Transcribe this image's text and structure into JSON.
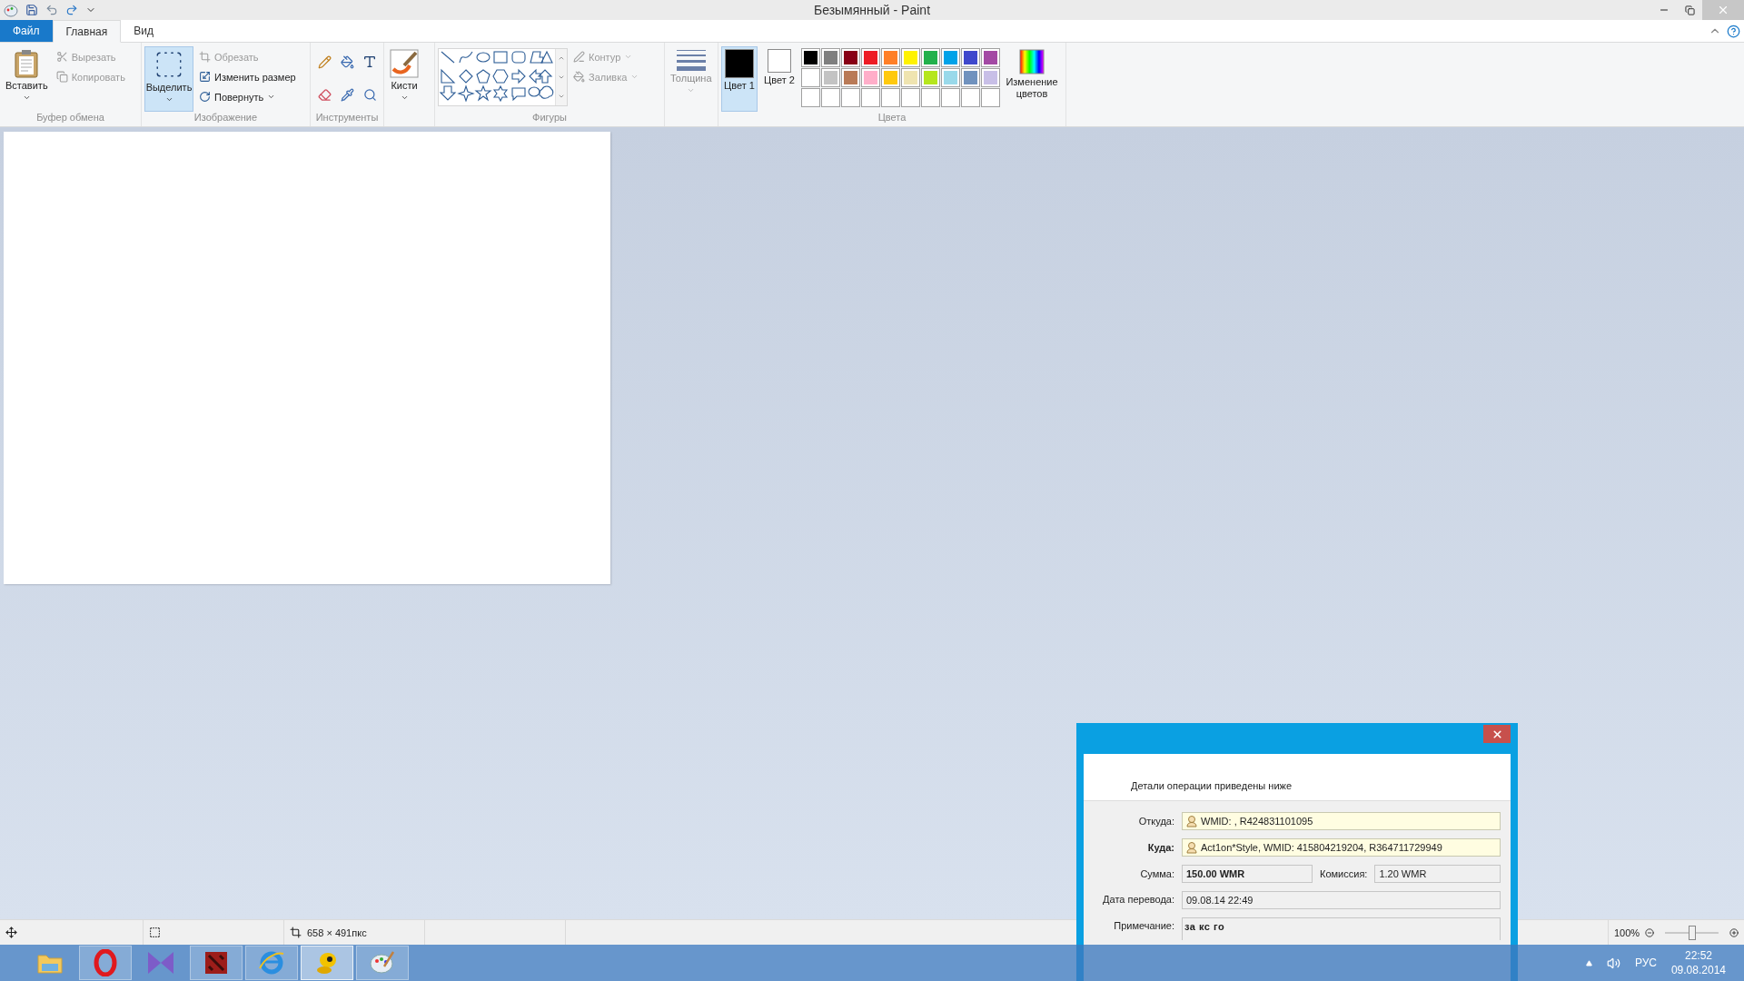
{
  "window": {
    "title": "Безымянный - Paint"
  },
  "ribbon_tabs": [
    {
      "label": "Файл",
      "kind": "file",
      "selected": false
    },
    {
      "label": "Главная",
      "kind": "tab",
      "selected": true
    },
    {
      "label": "Вид",
      "kind": "tab",
      "selected": false
    }
  ],
  "clipboard": {
    "label": "Буфер обмена",
    "paste": "Вставить",
    "cut": {
      "label": "Вырезать",
      "disabled": true
    },
    "copy": {
      "label": "Копировать",
      "disabled": true
    }
  },
  "image": {
    "label": "Изображение",
    "select": {
      "label": "Выделить",
      "selected": true
    },
    "crop": {
      "label": "Обрезать",
      "disabled": true
    },
    "resize": {
      "label": "Изменить размер",
      "disabled": false
    },
    "rotate": {
      "label": "Повернуть",
      "disabled": false
    }
  },
  "tools": {
    "label": "Инструменты"
  },
  "brushes": {
    "label": "Кисти"
  },
  "shapes": {
    "label": "Фигуры",
    "outline": {
      "label": "Контур",
      "disabled": true
    },
    "fill": {
      "label": "Заливка",
      "disabled": true
    }
  },
  "size": {
    "label": "Толщина",
    "disabled": true
  },
  "colors": {
    "label": "Цвета",
    "color1": {
      "label": "Цвет 1",
      "color": "#000000",
      "selected": true
    },
    "color2": {
      "label": "Цвет 2",
      "color": "#ffffff",
      "selected": false
    },
    "palette": [
      {
        "color": "#000000"
      },
      {
        "color": "#7f7f7f"
      },
      {
        "color": "#880015"
      },
      {
        "color": "#ed1c24"
      },
      {
        "color": "#ff7f27"
      },
      {
        "color": "#fff200"
      },
      {
        "color": "#22b14c"
      },
      {
        "color": "#00a2e8"
      },
      {
        "color": "#3f48cc"
      },
      {
        "color": "#a349a4"
      },
      {
        "color": "#ffffff"
      },
      {
        "color": "#c3c3c3"
      },
      {
        "color": "#b97a57"
      },
      {
        "color": "#ffaec9"
      },
      {
        "color": "#ffc90e"
      },
      {
        "color": "#efe4b0"
      },
      {
        "color": "#b5e61d"
      },
      {
        "color": "#99d9ea"
      },
      {
        "color": "#7092be"
      },
      {
        "color": "#c8bfe7"
      }
    ],
    "edit": "Изменение цветов"
  },
  "status_bar": {
    "dimensions": "658 × 491пкс",
    "zoom": "100%",
    "zoom_slider": {
      "level": 0.5
    }
  },
  "dialog": {
    "header": "Детали операции приведены ниже",
    "from": {
      "label": "Откуда:",
      "value": "WMID: , R424831101095"
    },
    "to": {
      "label": "Куда:",
      "value": "Act1on*Style, WMID: 415804219204, R364711729949"
    },
    "amount": {
      "label": "Сумма:",
      "value": "150.00 WMR"
    },
    "fee": {
      "label": "Комиссия:",
      "value": "1.20 WMR"
    },
    "date": {
      "label": "Дата перевода:",
      "value": "09.08.14 22:49"
    },
    "note": {
      "label": "Примечание:",
      "value": "за кс го"
    }
  },
  "taskbar": {
    "apps": [
      {
        "kind": "explorer",
        "running": false,
        "selected": false
      },
      {
        "kind": "opera",
        "running": true,
        "selected": false
      },
      {
        "kind": "studio",
        "running": false,
        "selected": false
      },
      {
        "kind": "game",
        "running": true,
        "selected": false
      },
      {
        "kind": "browser",
        "running": true,
        "selected": false
      },
      {
        "kind": "messenger",
        "running": true,
        "selected": true
      },
      {
        "kind": "paint",
        "running": true,
        "selected": false
      }
    ],
    "language": "РУС",
    "time": "22:52",
    "date": "09.08.2014"
  }
}
